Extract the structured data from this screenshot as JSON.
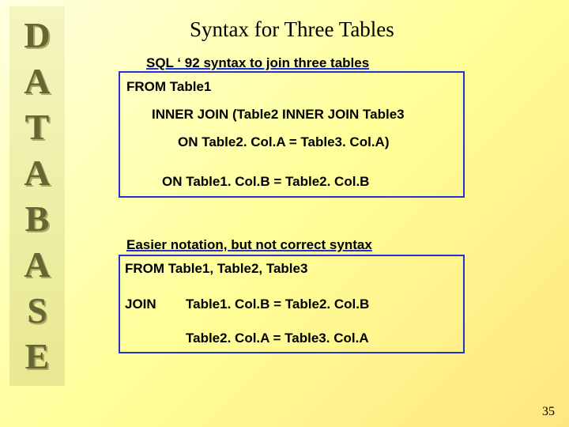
{
  "sidebar_letters": [
    "D",
    "A",
    "T",
    "A",
    "B",
    "A",
    "S",
    "E"
  ],
  "title": "Syntax for Three Tables",
  "section1": {
    "heading": "SQL ‘ 92 syntax to join three tables",
    "line1": "FROM Table1",
    "line2": "INNER JOIN (Table2 INNER JOIN Table3",
    "line3": "ON Table2. Col.A = Table3. Col.A)",
    "line4": "ON Table1. Col.B = Table2. Col.B"
  },
  "section2": {
    "heading": "Easier notation, but not correct syntax",
    "line1": "FROM Table1, Table2, Table3",
    "line2a": "JOIN",
    "line2b": "Table1. Col.B = Table2. Col.B",
    "line3": "Table2. Col.A = Table3. Col.A"
  },
  "page_number": "35"
}
